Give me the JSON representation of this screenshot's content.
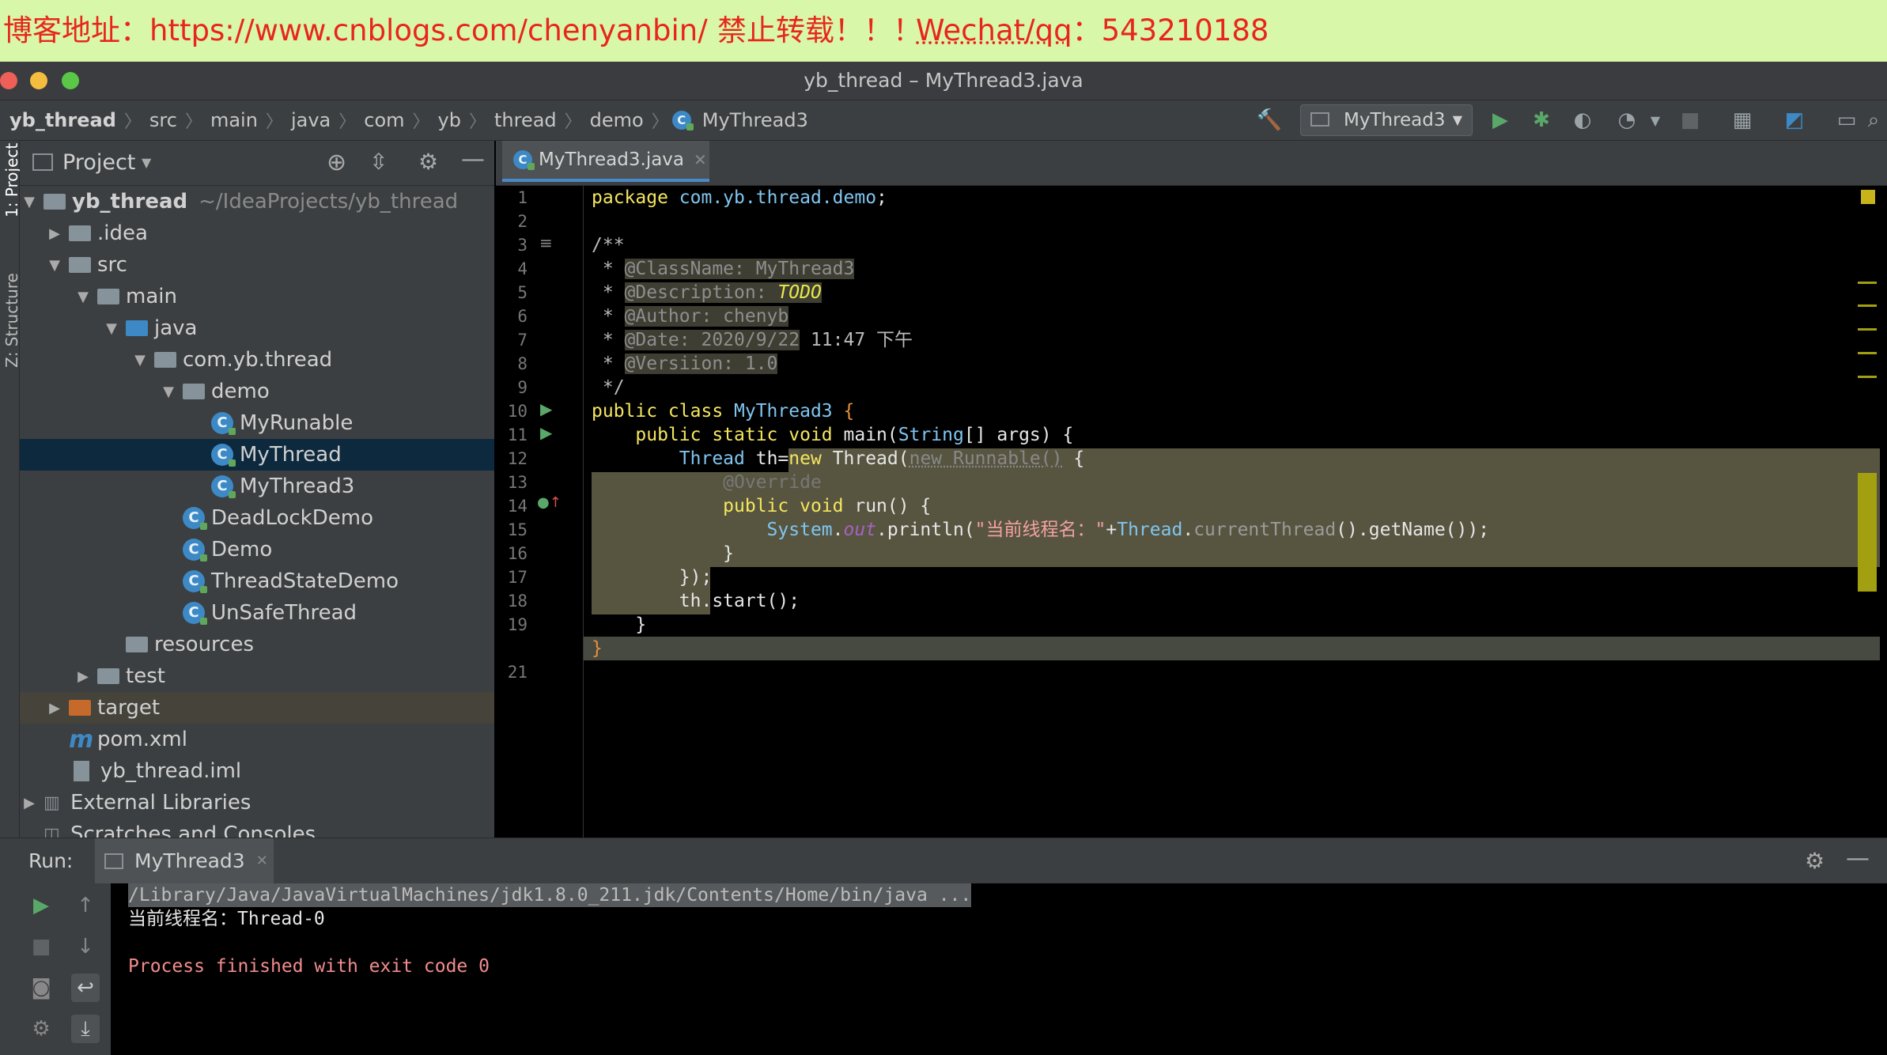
{
  "banner": {
    "blog": "博客地址：https://www.cnblogs.com/chenyanbin/",
    "notice": "禁止转载！！！",
    "contact_prefix": "Wechat/qq",
    "contact_suffix": "：543210188"
  },
  "window": {
    "title": "yb_thread – MyThread3.java"
  },
  "breadcrumb": [
    "yb_thread",
    "src",
    "main",
    "java",
    "com",
    "yb",
    "thread",
    "demo",
    "MyThread3"
  ],
  "toolbar": {
    "run_config": "MyThread3"
  },
  "side_tabs": {
    "project": "1: Project",
    "structure": "Z: Structure"
  },
  "project_panel": {
    "title": "Project",
    "tree": [
      {
        "label": "yb_thread",
        "extra": "~/IdeaProjects/yb_thread",
        "icon": "module-folder-icon",
        "expanded": true
      },
      {
        "label": ".idea",
        "icon": "folder-icon",
        "expanded": false
      },
      {
        "label": "src",
        "icon": "folder-icon",
        "expanded": true
      },
      {
        "label": "main",
        "icon": "folder-icon",
        "expanded": true
      },
      {
        "label": "java",
        "icon": "source-folder-icon",
        "expanded": true
      },
      {
        "label": "com.yb.thread",
        "icon": "package-icon",
        "expanded": true
      },
      {
        "label": "demo",
        "icon": "package-icon",
        "expanded": true
      },
      {
        "label": "MyRunable",
        "icon": "class-icon"
      },
      {
        "label": "MyThread",
        "icon": "class-icon",
        "selected": true
      },
      {
        "label": "MyThread3",
        "icon": "class-icon"
      },
      {
        "label": "DeadLockDemo",
        "icon": "class-icon"
      },
      {
        "label": "Demo",
        "icon": "class-icon"
      },
      {
        "label": "ThreadStateDemo",
        "icon": "class-icon"
      },
      {
        "label": "UnSafeThread",
        "icon": "class-icon"
      },
      {
        "label": "resources",
        "icon": "resources-folder-icon"
      },
      {
        "label": "test",
        "icon": "folder-icon",
        "expanded": false
      },
      {
        "label": "target",
        "icon": "excluded-folder-icon",
        "expanded": false
      },
      {
        "label": "pom.xml",
        "icon": "maven-icon"
      },
      {
        "label": "yb_thread.iml",
        "icon": "iml-file-icon"
      },
      {
        "label": "External Libraries",
        "icon": "libraries-icon",
        "expanded": false
      },
      {
        "label": "Scratches and Consoles",
        "icon": "scratches-icon"
      }
    ]
  },
  "editor": {
    "tab": "MyThread3.java",
    "line_numbers": [
      "1",
      "2",
      "3",
      "4",
      "5",
      "6",
      "7",
      "8",
      "9",
      "10",
      "11",
      "12",
      "13",
      "14",
      "15",
      "16",
      "17",
      "18",
      "19",
      "",
      "21"
    ],
    "code": {
      "l1_kw": "package",
      "l1_pkg": "com.yb.thread.demo",
      "l1_end": ";",
      "l3": "/**",
      "l4_star": " * ",
      "l4_tag": "@ClassName: MyThread3",
      "l5_star": " * ",
      "l5_tag": "@Description: ",
      "l5_todo": "TODO",
      "l6_star": " * ",
      "l6_tag": "@Author: chenyb",
      "l7_star": " * ",
      "l7_tag": "@Date: 2020/9/22",
      "l7_rest": " 11:47 下午",
      "l8_star": " * ",
      "l8_tag": "@Versiion: 1.0",
      "l9": " */",
      "l10_kw": "public class ",
      "l10_name": "MyThread3",
      "l10_end": " {",
      "l11_kw": "    public static void ",
      "l11_main": "main(",
      "l11_type": "String",
      "l11_end": "[] args) {",
      "l12_type": "        Thread",
      "l12_a": " th=",
      "l12_new": "new",
      "l12_b": " Thread(",
      "l12_grey": "new Runnable()",
      "l12_end": " {",
      "l13": "            @Override",
      "l14_kw": "            public void ",
      "l14_end": "run() {",
      "l15_sys": "                System",
      "l15_dot": ".",
      "l15_out": "out",
      "l15_print": ".println(",
      "l15_str": "\"当前线程名：\"",
      "l15_plus": "+",
      "l15_thread": "Thread",
      "l15_dot2": ".",
      "l15_ct": "currentThread",
      "l15_end": "().getName());",
      "l16": "            }",
      "l17": "        });",
      "l18": "        th.start();",
      "l19": "    }",
      "l20": "}"
    }
  },
  "run_panel": {
    "label": "Run:",
    "tab": "MyThread3",
    "console": [
      "/Library/Java/JavaVirtualMachines/jdk1.8.0_211.jdk/Contents/Home/bin/java ...",
      "当前线程名：Thread-0",
      "",
      "Process finished with exit code 0"
    ]
  },
  "colors": {
    "banner_bg": "#d9f7a8",
    "banner_text": "#e8261d",
    "selection": "#0d293e",
    "accent": "#4a88c7"
  }
}
